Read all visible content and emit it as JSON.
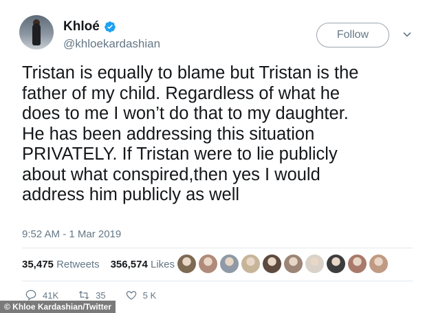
{
  "header": {
    "display_name": "Khloé",
    "handle": "@khloekardashian",
    "follow_label": "Follow"
  },
  "tweet": {
    "lines": [
      "Tristan is equally to blame but Tristan is the",
      "father of my child. Regardless of what he",
      "does to me I won’t do that to my daughter.",
      "He has been addressing this situation",
      "PRIVATELY. If Tristan were to lie publicly",
      "about what conspired,then yes I would",
      "address him publicly as well"
    ],
    "timestamp": "9:52 AM - 1 Mar 2019"
  },
  "stats": {
    "retweets_count": "35,475",
    "retweets_label": "Retweets",
    "likes_count": "356,574",
    "likes_label": "Likes"
  },
  "actions": {
    "reply_count": "41K",
    "retweet_count": "35",
    "like_count": "5 K"
  },
  "liker_avatars": [
    "#7d6a52",
    "#b08a7a",
    "#8f9aa6",
    "#c7b59a",
    "#5e4a3e",
    "#9c8577",
    "#d9d2c8",
    "#3d3d3d",
    "#a97a6b",
    "#c09a82"
  ],
  "credit": "© Khloe Kardashian/Twitter",
  "colors": {
    "verified": "#1da1f2",
    "secondary_text": "#657786",
    "primary_text": "#14171a"
  }
}
